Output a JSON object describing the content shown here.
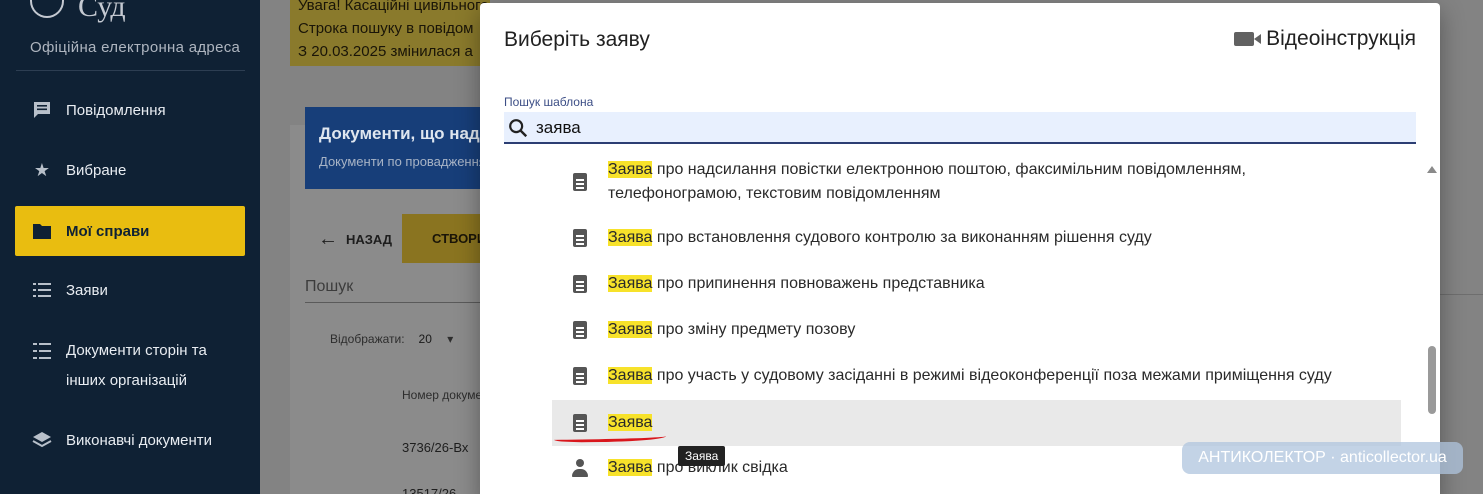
{
  "app": {
    "logo_text": "Суд",
    "logo_subtitle": "Офіційна електронна адреса"
  },
  "sidebar": {
    "items": [
      {
        "label": "Повідомлення",
        "icon": "message-icon"
      },
      {
        "label": "Вибране",
        "icon": "star-icon"
      },
      {
        "label": "Мої справи",
        "icon": "folder-icon",
        "active": true
      },
      {
        "label": "Заяви",
        "icon": "list-icon"
      },
      {
        "label": "Документи сторін та інших організацій",
        "icon": "checklist-icon"
      },
      {
        "label": "Виконавчі документи",
        "icon": "layers-icon"
      }
    ]
  },
  "background": {
    "warning_lines": [
      "Увага! Касаційні цивільного та комерційного суду ставки ...",
      "Строка пошуку в повідом",
      "З 20.03.2025 змінилася а"
    ],
    "card_title": "Документи, що над",
    "card_subtitle": "Документи по провадження",
    "back_label": "НАЗАД",
    "create_label": "СТВОРИ",
    "search_placeholder": "Пошук",
    "show_label": "Відображати:",
    "show_value": "20",
    "column_header": "Номер документа",
    "row1": "3736/26-Вх",
    "row2": "13517/26"
  },
  "dialog": {
    "title": "Виберіть заяву",
    "video_label": "Відеоінструкція",
    "search_label": "Пошук шаблона",
    "search_value": "заява",
    "items": [
      {
        "highlight": "Заява",
        "rest": " про надсилання повістки електронною поштою, факсимільним повідомленням,",
        "rest2": "телефонограмою, текстовим повідомленням",
        "icon": "document-icon"
      },
      {
        "highlight": "Заява",
        "rest": " про встановлення судового контролю за виконанням рішення суду",
        "icon": "document-icon"
      },
      {
        "highlight": "Заява",
        "rest": " про припинення повноважень представника",
        "icon": "document-icon"
      },
      {
        "highlight": "Заява",
        "rest": " про зміну предмету позову",
        "icon": "document-icon"
      },
      {
        "highlight": "Заява",
        "rest": " про участь у судовому засіданні в режимі відеоконференції поза межами приміщення суду",
        "icon": "document-icon"
      },
      {
        "highlight": "Заява",
        "rest": "",
        "icon": "document-icon",
        "hovered": true
      },
      {
        "highlight": "Заява",
        "rest": " про виклик свідка",
        "icon": "person-icon"
      }
    ],
    "tooltip": "Заява"
  },
  "watermark": "АНТИКОЛЕКТОР · anticollector.ua",
  "colors": {
    "sidebar_bg": "#0f2134",
    "accent": "#e9bd10",
    "highlight": "#f7e22a",
    "annotation_red": "#d9161c"
  }
}
